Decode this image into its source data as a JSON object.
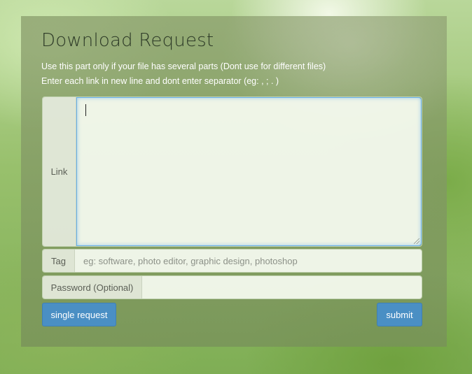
{
  "form": {
    "title": "Download Request",
    "note_line1": "Use this part only if your file has several parts (Dont use for different files)",
    "note_line2": "Enter each link in new line and dont enter separator (eg: , ; . )",
    "link": {
      "label": "Link",
      "value": ""
    },
    "tag": {
      "label": "Tag",
      "value": "",
      "placeholder": "eg: software, photo editor, graphic design, photoshop"
    },
    "password": {
      "label": "Password (Optional)",
      "value": ""
    },
    "buttons": {
      "single_request": "single request",
      "submit": "submit"
    }
  },
  "colors": {
    "button_primary": "#4a8fc4",
    "focus_border": "#66afe9",
    "title_text": "#2d3a27"
  }
}
